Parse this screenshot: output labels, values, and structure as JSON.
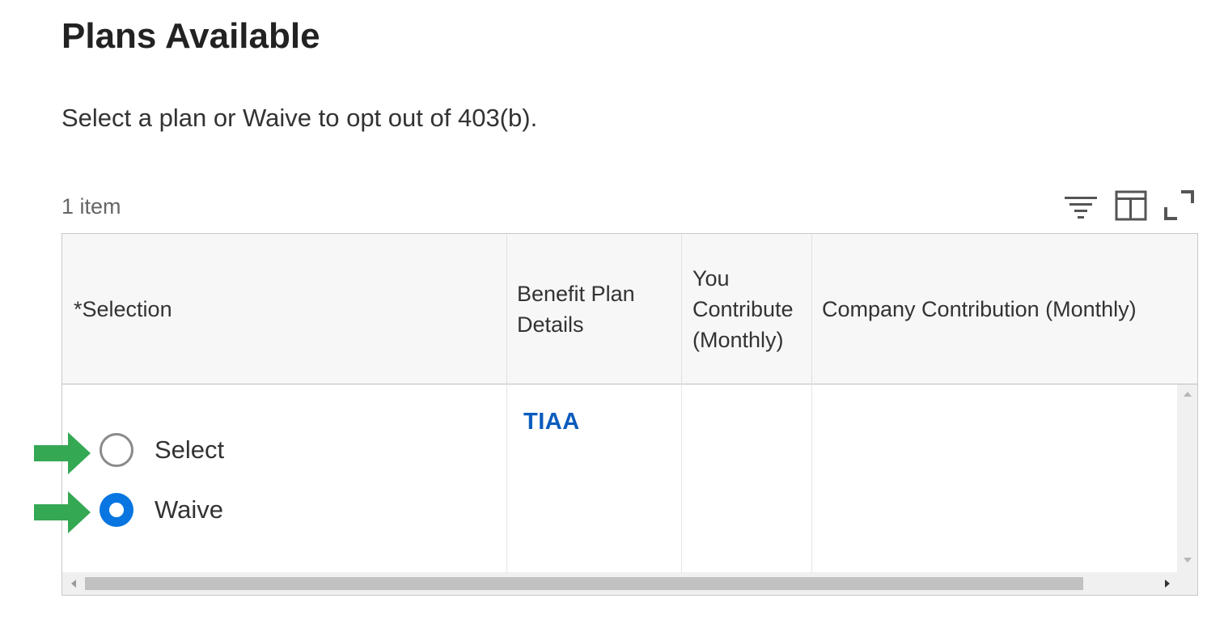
{
  "page": {
    "title": "Plans Available",
    "instruction": "Select a plan or Waive to opt out of 403(b).",
    "item_count": "1 item"
  },
  "toolbar": {
    "icons": [
      "filter-icon",
      "column-layout-icon",
      "expand-icon"
    ]
  },
  "table": {
    "headers": {
      "selection": "*Selection",
      "benefit_plan_details": "Benefit Plan Details",
      "you_contribute": "You Contribute (Monthly)",
      "company_contribution": "Company Contribution (Monthly)"
    },
    "row": {
      "options": [
        {
          "label": "Select",
          "checked": false
        },
        {
          "label": "Waive",
          "checked": true
        }
      ],
      "plan": "TIAA",
      "you_contribute": "",
      "company_contribution": ""
    }
  },
  "colors": {
    "radio_selected": "#0875e1",
    "link": "#0b5cbd",
    "annotation_arrow": "#34a853"
  }
}
